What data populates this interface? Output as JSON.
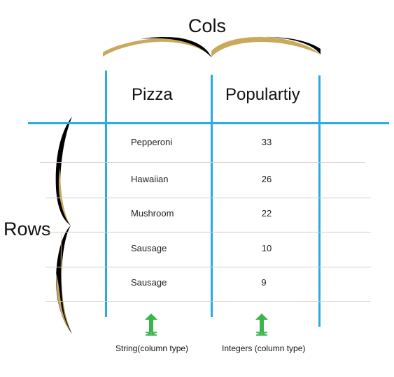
{
  "title_cols": "Cols",
  "title_rows": "Rows",
  "table": {
    "headers": [
      "Pizza",
      "Populartiy"
    ],
    "rows": [
      {
        "pizza": "Pepperoni",
        "popularity": "33"
      },
      {
        "pizza": "Hawaiian",
        "popularity": "26"
      },
      {
        "pizza": "Mushroom",
        "popularity": "22"
      },
      {
        "pizza": "Sausage",
        "popularity": "10"
      },
      {
        "pizza": "Sausage",
        "popularity": "9"
      }
    ]
  },
  "captions": {
    "col1": "String(column type)",
    "col2": "Integers (column type)"
  },
  "colors": {
    "grid_blue": "#29abe2",
    "brace_gold": "#c9a95c",
    "brace_black": "#000000",
    "arrow_green": "#39b54a",
    "row_line": "#d8cbc4"
  },
  "icons": {
    "cols_brace": "horizontal-curly-brace",
    "rows_brace": "vertical-curly-brace",
    "arrow_col1": "up-arrow",
    "arrow_col2": "up-arrow"
  }
}
